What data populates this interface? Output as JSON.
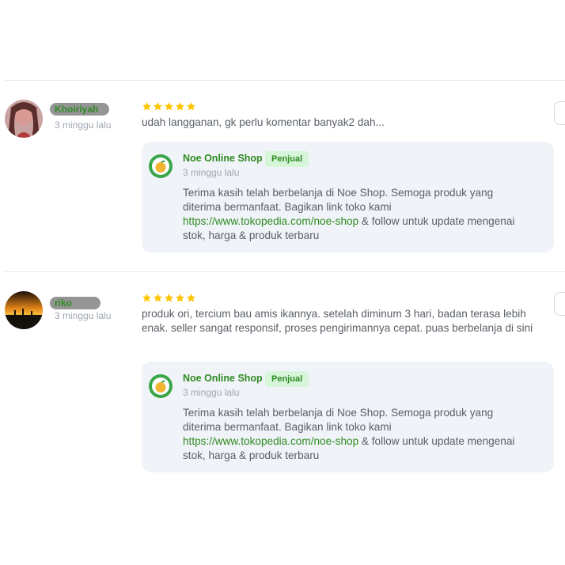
{
  "reviews": [
    {
      "username": "Khoiriyah",
      "time": "3 minggu lalu",
      "rating": 5,
      "comment": "udah langganan, gk perlu komentar banyak2 dah...",
      "avatar_icon": "user-photo-avatar",
      "reply": {
        "shop_name": "Noe Online Shop",
        "badge": "Penjual",
        "time": "3 minggu lalu",
        "text_before": "Terima kasih telah berbelanja di Noe Shop. Semoga produk yang diterima bermanfaat. Bagikan link toko kami ",
        "link": "https://www.tokopedia.com/noe-shop",
        "text_after": " & follow untuk update mengenai stok, harga & produk terbaru"
      }
    },
    {
      "username": "riko",
      "time": "3 minggu lalu",
      "rating": 5,
      "comment": "produk ori, tercium bau amis ikannya. setelah diminum 3 hari, badan terasa lebih enak. seller sangat responsif, proses pengirimannya cepat. puas berbelanja di sini",
      "avatar_icon": "sunset-photo-avatar",
      "reply": {
        "shop_name": "Noe Online Shop",
        "badge": "Penjual",
        "time": "3 minggu lalu",
        "text_before": "Terima kasih telah berbelanja di Noe Shop. Semoga produk yang diterima bermanfaat. Bagikan link toko kami ",
        "link": "https://www.tokopedia.com/noe-shop",
        "text_after": " & follow untuk update mengenai stok, harga & produk terbaru"
      }
    }
  ],
  "colors": {
    "accent_green": "#2e8b22",
    "star_yellow": "#ffc400",
    "reply_bg": "#f0f3f7",
    "badge_bg": "#d6f5d9"
  }
}
